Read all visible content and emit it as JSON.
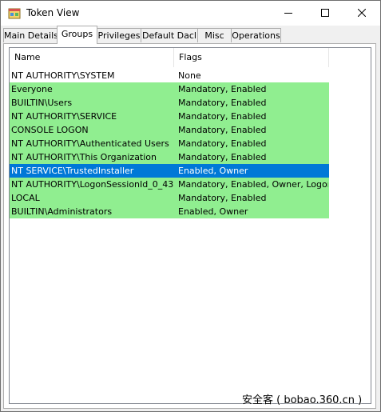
{
  "window": {
    "title": "Token View",
    "icon": "token-app-icon"
  },
  "tabs": [
    {
      "label": "Main Details",
      "active": false
    },
    {
      "label": "Groups",
      "active": true
    },
    {
      "label": "Privileges",
      "active": false
    },
    {
      "label": "Default Dacl",
      "active": false
    },
    {
      "label": "Misc",
      "active": false
    },
    {
      "label": "Operations",
      "active": false
    }
  ],
  "groups_list": {
    "columns": [
      "Name",
      "Flags"
    ],
    "rows": [
      {
        "name": "NT AUTHORITY\\SYSTEM",
        "flags": "None",
        "state": "normal"
      },
      {
        "name": "Everyone",
        "flags": "Mandatory, Enabled",
        "state": "enabled"
      },
      {
        "name": "BUILTIN\\Users",
        "flags": "Mandatory, Enabled",
        "state": "enabled"
      },
      {
        "name": "NT AUTHORITY\\SERVICE",
        "flags": "Mandatory, Enabled",
        "state": "enabled"
      },
      {
        "name": "CONSOLE LOGON",
        "flags": "Mandatory, Enabled",
        "state": "enabled"
      },
      {
        "name": "NT AUTHORITY\\Authenticated Users",
        "flags": "Mandatory, Enabled",
        "state": "enabled"
      },
      {
        "name": "NT AUTHORITY\\This Organization",
        "flags": "Mandatory, Enabled",
        "state": "enabled"
      },
      {
        "name": "NT SERVICE\\TrustedInstaller",
        "flags": "Enabled, Owner",
        "state": "selected"
      },
      {
        "name": "NT AUTHORITY\\LogonSessionId_0_43...",
        "flags": "Mandatory, Enabled, Owner, LogonId",
        "state": "enabled"
      },
      {
        "name": "LOCAL",
        "flags": "Mandatory, Enabled",
        "state": "enabled"
      },
      {
        "name": "BUILTIN\\Administrators",
        "flags": "Enabled, Owner",
        "state": "enabled"
      }
    ]
  },
  "colors": {
    "enabled_row": "#90ee90",
    "selected_row": "#0078d7",
    "selected_text": "#ffffff"
  },
  "watermark": "安全客 ( bobao.360.cn )"
}
